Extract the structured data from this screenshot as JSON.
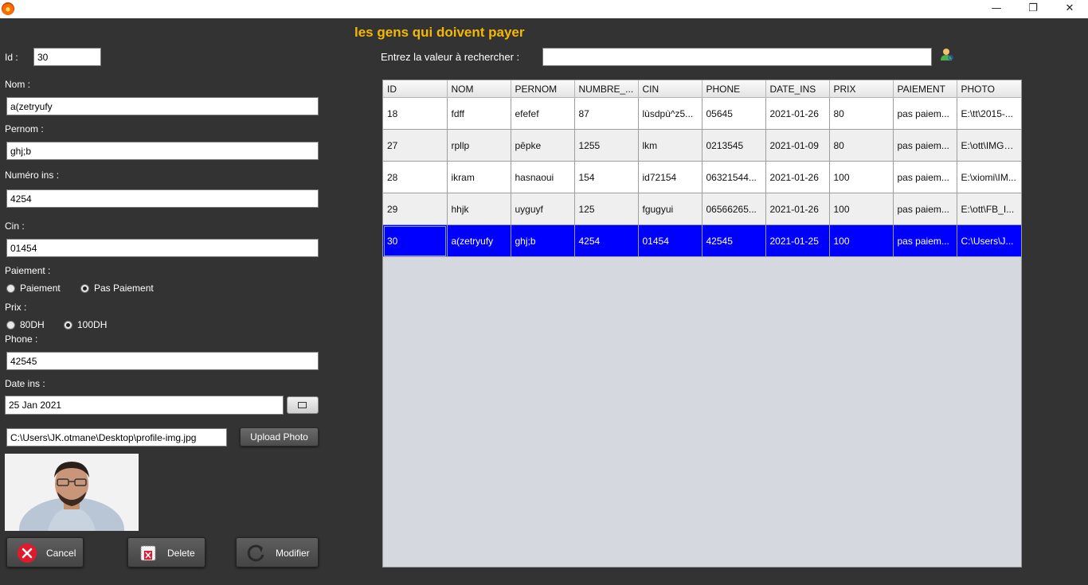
{
  "window": {
    "minimize": "—",
    "restore": "❐",
    "close": "✕"
  },
  "page_title": "les gens qui doivent payer",
  "form": {
    "id_label": "Id :",
    "id_value": "30",
    "nom_label": "Nom :",
    "nom_value": "a(zetryufy",
    "pernom_label": "Pernom :",
    "pernom_value": "ghj;b",
    "numero_label": "Numéro ins :",
    "numero_value": "4254",
    "cin_label": "Cin :",
    "cin_value": "01454",
    "paiement_label": "Paiement :",
    "paiement_options": [
      {
        "label": "Paiement",
        "selected": false
      },
      {
        "label": "Pas Paiement",
        "selected": true
      }
    ],
    "prix_label": "Prix :",
    "prix_options": [
      {
        "label": "80DH",
        "selected": false
      },
      {
        "label": "100DH",
        "selected": true
      }
    ],
    "phone_label": "Phone :",
    "phone_value": "42545",
    "date_label": "Date ins :",
    "date_value": "25 Jan 2021",
    "photo_path": "C:\\Users\\JK.otmane\\Desktop\\profile-img.jpg",
    "upload_label": "Upload Photo"
  },
  "actions": {
    "cancel": "Cancel",
    "delete": "Delete",
    "modifier": "Modifier"
  },
  "search": {
    "label": "Entrez la valeur à rechercher :",
    "value": ""
  },
  "table": {
    "columns": [
      "ID",
      "NOM",
      "PERNOM",
      "NUMBRE_...",
      "CIN",
      "PHONE",
      "DATE_INS",
      "PRIX",
      "PAIEMENT",
      "PHOTO"
    ],
    "rows": [
      [
        "18",
        "fdff",
        "efefef",
        "87",
        "lùsdpù^z5...",
        "05645",
        "2021-01-26",
        "80",
        "pas paiem...",
        "E:\\tt\\2015-..."
      ],
      [
        "27",
        "rpllp",
        "pêpke",
        "1255",
        "lkm",
        "0213545",
        "2021-01-09",
        "80",
        "pas paiem...",
        "E:\\ott\\IMG_..."
      ],
      [
        "28",
        "ikram",
        "hasnaoui",
        "154",
        "id72154",
        "06321544...",
        "2021-01-26",
        "100",
        "pas paiem...",
        "E:\\xiomi\\IM..."
      ],
      [
        "29",
        "hhjk",
        "uyguyf",
        "125",
        "fgugyui",
        "06566265...",
        "2021-01-26",
        "100",
        "pas paiem...",
        "E:\\ott\\FB_I..."
      ],
      [
        "30",
        "a(zetryufy",
        "ghj;b",
        "4254",
        "01454",
        "42545",
        "2021-01-25",
        "100",
        "pas paiem...",
        "C:\\Users\\J..."
      ]
    ],
    "selected_row": 4
  },
  "colors": {
    "background": "#333333",
    "title": "#f5b800",
    "selection": "#0000ff"
  },
  "icons": {
    "app": "app-icon",
    "search_user": "user-search-icon",
    "calendar": "calendar-icon",
    "cancel": "cancel-icon",
    "delete": "delete-icon",
    "modifier": "refresh-icon"
  }
}
